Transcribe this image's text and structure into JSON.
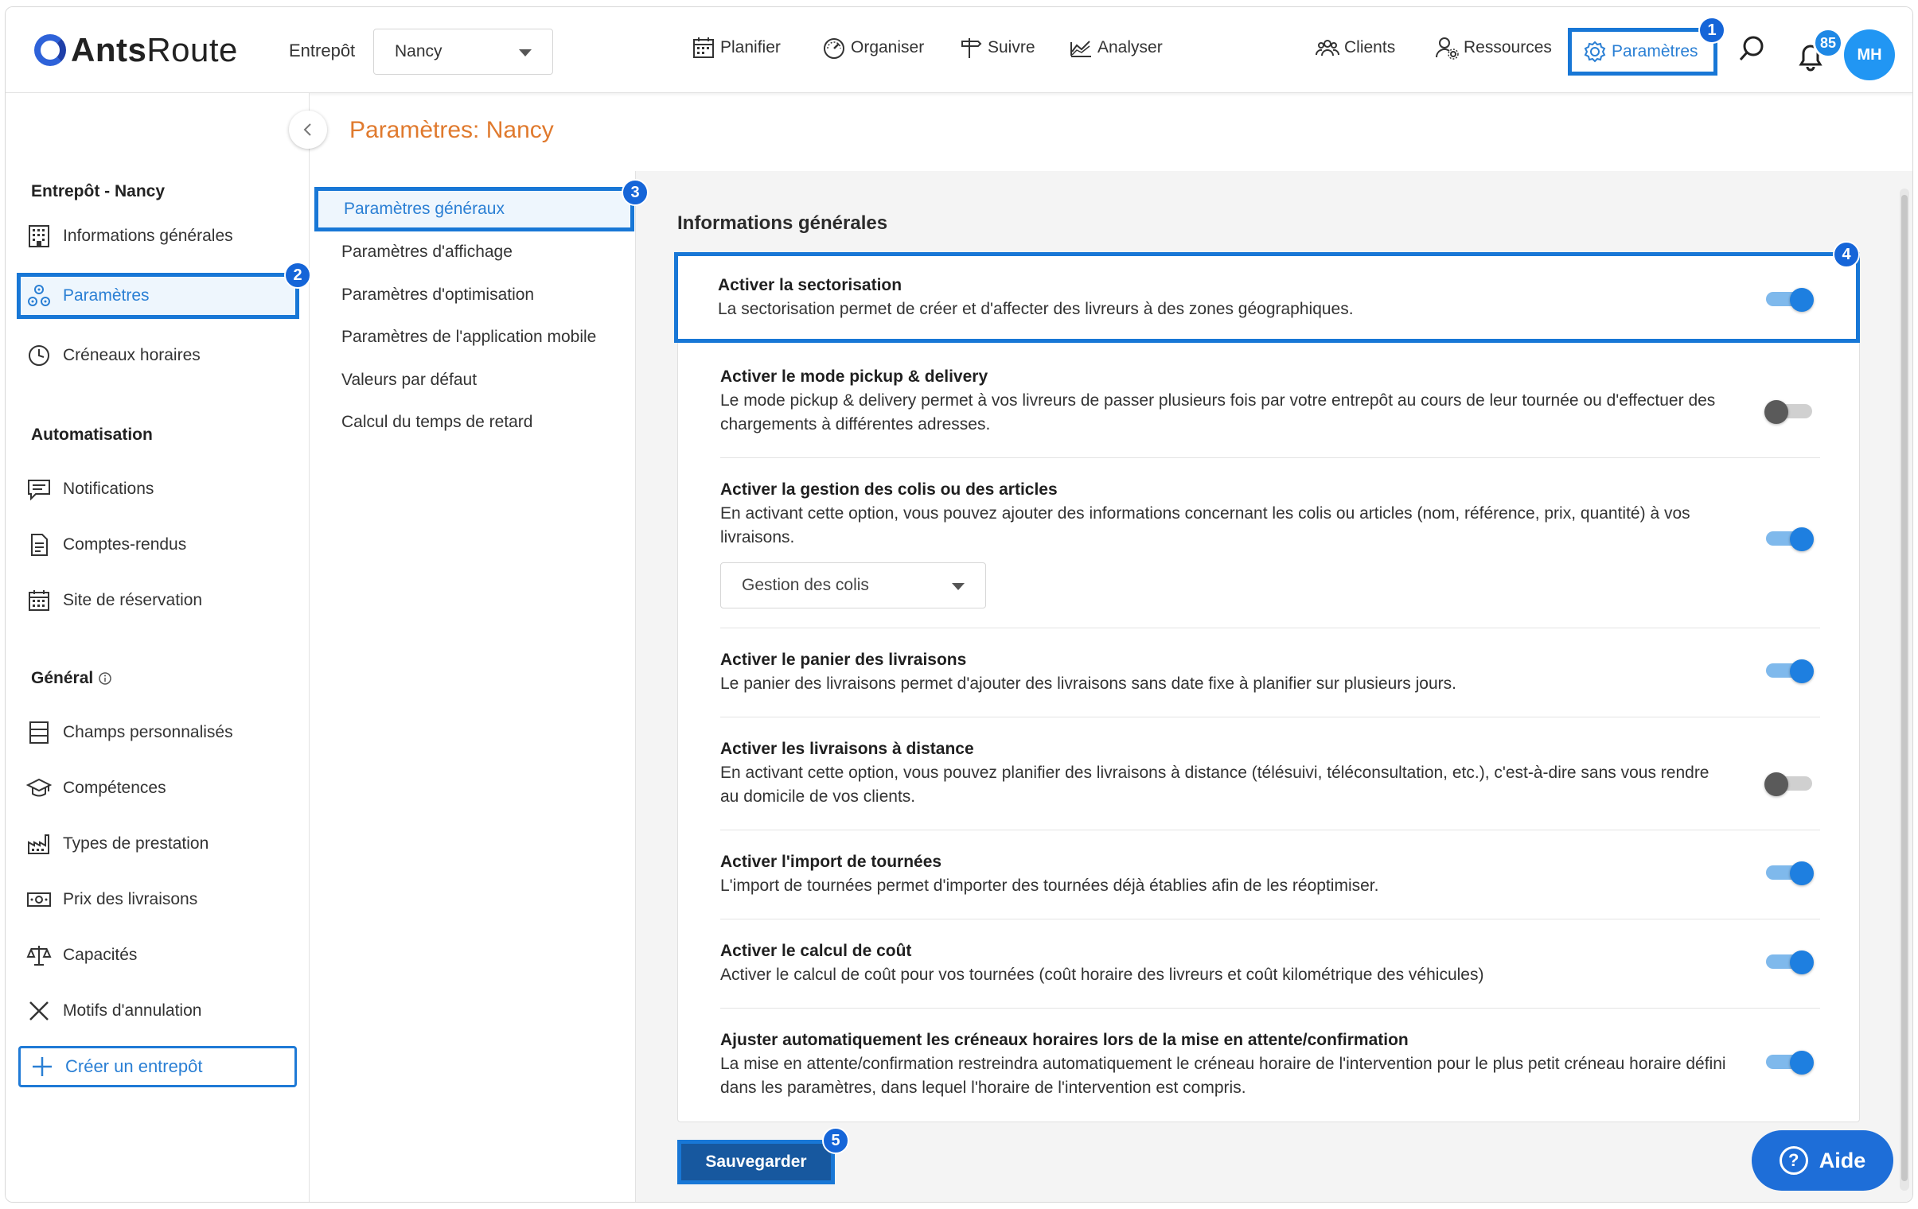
{
  "app": {
    "logo_bold": "Ants",
    "logo_light": "Route"
  },
  "topbar": {
    "warehouse_label": "Entrepôt",
    "warehouse_value": "Nancy",
    "nav_center": [
      "Planifier",
      "Organiser",
      "Suivre",
      "Analyser"
    ],
    "nav_clients": "Clients",
    "nav_resources": "Ressources",
    "nav_params": "Paramètres",
    "notif_count": "85",
    "avatar_initials": "MH"
  },
  "steps": [
    "1",
    "2",
    "3",
    "4",
    "5"
  ],
  "sidebar": {
    "group1_title": "Entrepôt - Nancy",
    "group1_items": [
      "Informations générales",
      "Paramètres",
      "Créneaux horaires"
    ],
    "group2_title": "Automatisation",
    "group2_items": [
      "Notifications",
      "Comptes-rendus",
      "Site de réservation"
    ],
    "group3_title": "Général",
    "group3_items": [
      "Champs personnalisés",
      "Compétences",
      "Types de prestation",
      "Prix des livraisons",
      "Capacités",
      "Motifs d'annulation"
    ],
    "create_label": "Créer un entrepôt"
  },
  "page_title": "Paramètres: Nancy",
  "midmenu": {
    "items": [
      "Paramètres généraux",
      "Paramètres d'affichage",
      "Paramètres d'optimisation",
      "Paramètres de l'application mobile",
      "Valeurs par défaut",
      "Calcul du temps de retard"
    ]
  },
  "content": {
    "section_title": "Informations générales",
    "settings": [
      {
        "title": "Activer la sectorisation",
        "desc": "La sectorisation permet de créer et d'affecter des livreurs à des zones géographiques.",
        "enabled": true
      },
      {
        "title": "Activer le mode pickup & delivery",
        "desc": "Le mode pickup & delivery permet à vos livreurs de passer plusieurs fois par votre entrepôt au cours de leur tournée ou d'effectuer des chargements à différentes adresses.",
        "enabled": false
      },
      {
        "title": "Activer la gestion des colis ou des articles",
        "desc": "En activant cette option, vous pouvez ajouter des informations concernant les colis ou articles (nom, référence, prix, quantité) à vos livraisons.",
        "enabled": true,
        "select_value": "Gestion des colis"
      },
      {
        "title": "Activer le panier des livraisons",
        "desc": "Le panier des livraisons permet d'ajouter des livraisons sans date fixe à planifier sur plusieurs jours.",
        "enabled": true
      },
      {
        "title": "Activer les livraisons à distance",
        "desc": "En activant cette option, vous pouvez planifier des livraisons à distance (télésuivi, téléconsultation, etc.), c'est-à-dire sans vous rendre au domicile de vos clients.",
        "enabled": false
      },
      {
        "title": "Activer l'import de tournées",
        "desc": "L'import de tournées permet d'importer des tournées déjà établies afin de les réoptimiser.",
        "enabled": true
      },
      {
        "title": "Activer le calcul de coût",
        "desc": "Activer le calcul de coût pour vos tournées (coût horaire des livreurs et coût kilométrique des véhicules)",
        "enabled": true
      },
      {
        "title": "Ajuster automatiquement les créneaux horaires lors de la mise en attente/confirmation",
        "desc": "La mise en attente/confirmation restreindra automatiquement le créneau horaire de l'intervention pour le plus petit créneau horaire défini dans les paramètres, dans lequel l'horaire de l'intervention est compris.",
        "enabled": true
      }
    ],
    "save_label": "Sauvegarder"
  },
  "help": {
    "label": "Aide",
    "glyph": "?"
  },
  "colors": {
    "accent": "#1877d6",
    "title_orange": "#e07a2e",
    "save_bg": "#17589f"
  }
}
